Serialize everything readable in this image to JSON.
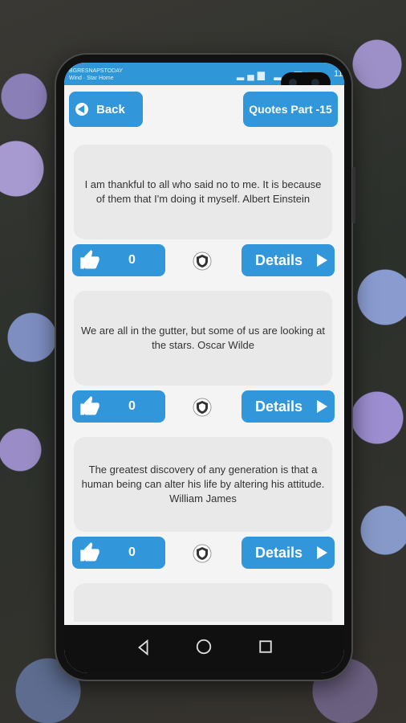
{
  "status": {
    "line1": "BGRESNAPSTODAY",
    "line2": "Wind · Star Home",
    "time": "11:1"
  },
  "appbar": {
    "back_label": "Back",
    "title": "Quotes Part -15"
  },
  "quotes": [
    {
      "text": "I am thankful to all who said no to me. It is because of them that I'm doing it myself. Albert Einstein",
      "likes": "0",
      "details_label": "Details"
    },
    {
      "text": "We are all in the gutter, but some of us are looking at the stars. Oscar Wilde",
      "likes": "0",
      "details_label": "Details"
    },
    {
      "text": "The greatest discovery of any generation is that a human being can alter his life by altering his attitude. William James",
      "likes": "0",
      "details_label": "Details"
    },
    {
      "text": "",
      "likes": "",
      "details_label": ""
    }
  ],
  "colors": {
    "accent": "#3296db",
    "card": "#e9e9e9",
    "statusbar": "#2f96d8"
  },
  "icons": [
    "back-arrow-icon",
    "thumbs-up-icon",
    "shield-icon",
    "play-icon",
    "nav-back-icon",
    "nav-home-icon",
    "nav-recent-icon"
  ]
}
